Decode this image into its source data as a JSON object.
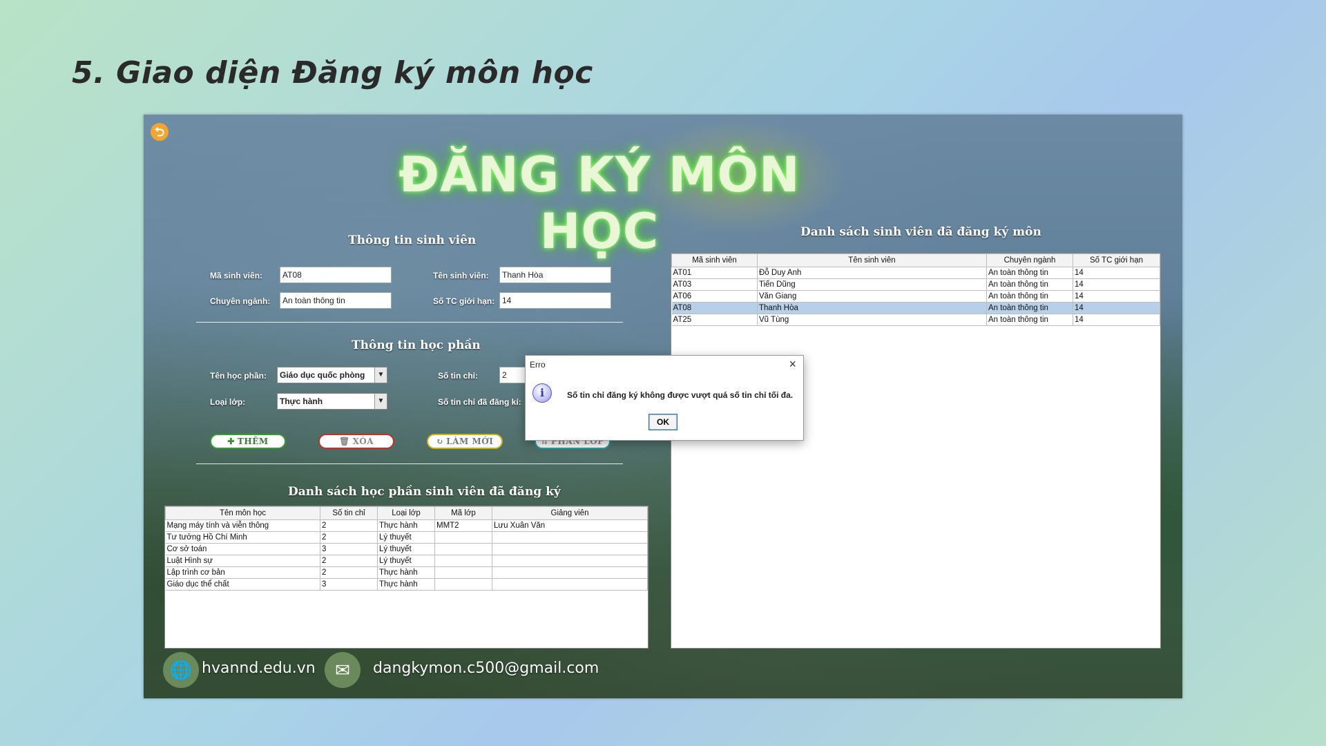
{
  "slide": {
    "title": "5. Giao diện Đăng ký môn học"
  },
  "app": {
    "title": "ĐĂNG KÝ MÔN HỌC",
    "back_icon": "back-arrow-icon",
    "student_section": {
      "heading": "Thông tin sinh viên",
      "ma_sv_label": "Mã sinh viên:",
      "ma_sv_value": "AT08",
      "ten_sv_label": "Tên sinh viên:",
      "ten_sv_value": "Thanh Hòa",
      "chuyen_nganh_label": "Chuyên ngành:",
      "chuyen_nganh_value": "An toàn thông tin",
      "so_tc_label": "Số TC giới hạn:",
      "so_tc_value": "14"
    },
    "course_section": {
      "heading": "Thông tin học phần",
      "ten_hp_label": "Tên học phần:",
      "ten_hp_value": "Giáo dục quốc phòng",
      "loai_lop_label": "Loại lớp:",
      "loai_lop_value": "Thực hành",
      "so_tin_chi_label": "Số tin chỉ:",
      "so_tin_chi_value": "2",
      "so_tin_chi_dk_label": "Số tin chỉ đã đăng kí:"
    },
    "buttons": {
      "them": "THÊM",
      "xoa": "XÓA",
      "lam_moi": "LÀM MỚI",
      "phan_lop": "PHÂN LỚP"
    },
    "course_table": {
      "heading": "Danh sách học phần sinh viên đã đăng ký",
      "columns": [
        "Tên môn học",
        "Số tin chỉ",
        "Loại lớp",
        "Mã lớp",
        "Giảng viên"
      ],
      "rows": [
        [
          "Mạng máy tính và viễn thông",
          "2",
          "Thực hành",
          "MMT2",
          "Lưu Xuân Văn"
        ],
        [
          "Tư tưởng Hồ Chí Minh",
          "2",
          "Lý thuyết",
          "",
          ""
        ],
        [
          "Cơ sở toán",
          "3",
          "Lý thuyết",
          "",
          ""
        ],
        [
          "Luật Hình sự",
          "2",
          "Lý thuyết",
          "",
          ""
        ],
        [
          "Lập trình cơ bản",
          "2",
          "Thực hành",
          "",
          ""
        ],
        [
          "Giáo dục thể chất",
          "3",
          "Thực hành",
          "",
          ""
        ]
      ]
    },
    "student_table": {
      "heading": "Danh sách sinh viên đã đăng ký môn",
      "columns": [
        "Mã sinh viên",
        "Tên sinh viên",
        "Chuyên ngành",
        "Số TC giới hạn"
      ],
      "rows": [
        [
          "AT01",
          "Đỗ Duy Anh",
          "An toàn thông tin",
          "14"
        ],
        [
          "AT03",
          "Tiến Dũng",
          "An toàn thông tin",
          "14"
        ],
        [
          "AT06",
          "Văn Giang",
          "An toàn thông tin",
          "14"
        ],
        [
          "AT08",
          "Thanh Hòa",
          "An toàn thông tin",
          "14"
        ],
        [
          "AT25",
          "Vũ Tùng",
          "An toàn thông tin",
          "14"
        ]
      ],
      "selected_row": 3
    },
    "footer": {
      "website": "hvannd.edu.vn",
      "email": "dangkymon.c500@gmail.com"
    }
  },
  "dialog": {
    "title": "Erro",
    "message": "Số tin chỉ đăng ký không được vượt quá số tin chỉ tối đa.",
    "ok_label": "OK",
    "icon": "info-icon"
  },
  "colors": {
    "them_border": "#3a9a3a",
    "xoa_border": "#c0302a",
    "lam_moi_border": "#c9b21c",
    "phan_lop_border": "#2aa0a0",
    "title_glow": "#9cff7a",
    "selected_row": "#b8cfe8"
  }
}
